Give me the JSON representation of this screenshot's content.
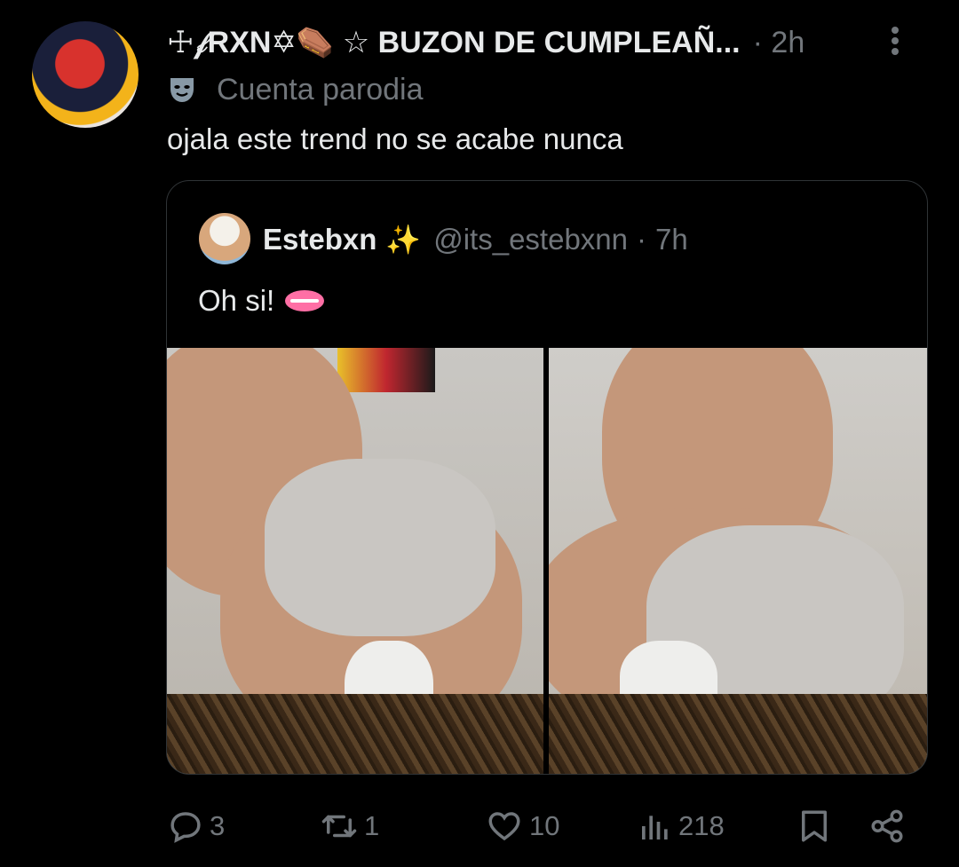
{
  "post": {
    "author_name": "☩𝒻RXN✡⚰️ ☆ BUZON DE CUMPLEAÑ...",
    "separator": "·",
    "time": "2h",
    "parody_label": "Cuenta parodia",
    "text": "ojala este trend no se acabe nunca"
  },
  "quote": {
    "author_name": "Estebxn",
    "emoji": "✨",
    "handle": "@its_estebxnn",
    "separator": "·",
    "time": "7h",
    "text": "Oh si!"
  },
  "actions": {
    "replies": "3",
    "reposts": "1",
    "likes": "10",
    "views": "218"
  },
  "colors": {
    "background": "#000000",
    "text_primary": "#e7e9ea",
    "text_secondary": "#71767b",
    "border": "#2f3336"
  },
  "icons": [
    "more-icon",
    "parody-mask-icon",
    "reply-icon",
    "repost-icon",
    "like-icon",
    "views-icon",
    "bookmark-icon",
    "share-icon"
  ]
}
